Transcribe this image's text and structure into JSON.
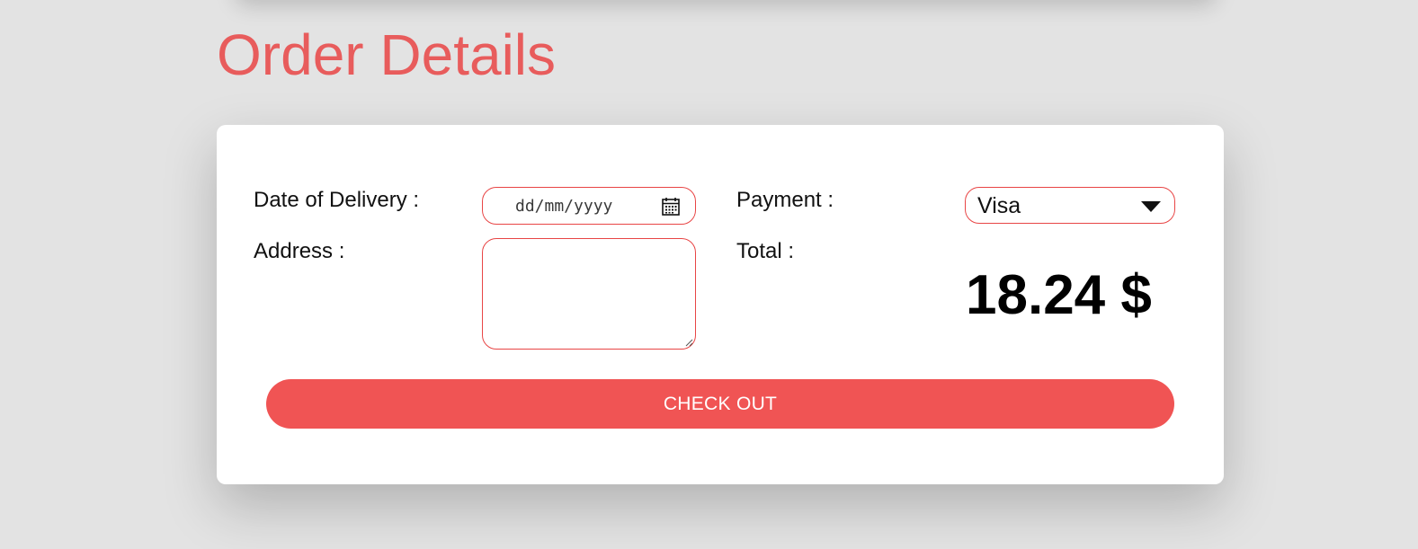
{
  "page": {
    "title": "Order Details"
  },
  "form": {
    "date_label": "Date of Delivery :",
    "date_placeholder": "dd/mm/yyyy",
    "address_label": "Address :",
    "address_value": "",
    "payment_label": "Payment :",
    "payment_selected": "Visa",
    "total_label": "Total :",
    "total_value": "18.24 $"
  },
  "actions": {
    "checkout_label": "CHECK OUT"
  },
  "icons": {
    "calendar": "calendar-icon",
    "dropdown": "chevron-down-icon",
    "resize": "resize-handle-icon"
  },
  "colors": {
    "accent": "#f05454",
    "title": "#e85c5c",
    "border": "#e84545",
    "background": "#e3e3e3",
    "card": "#ffffff"
  }
}
